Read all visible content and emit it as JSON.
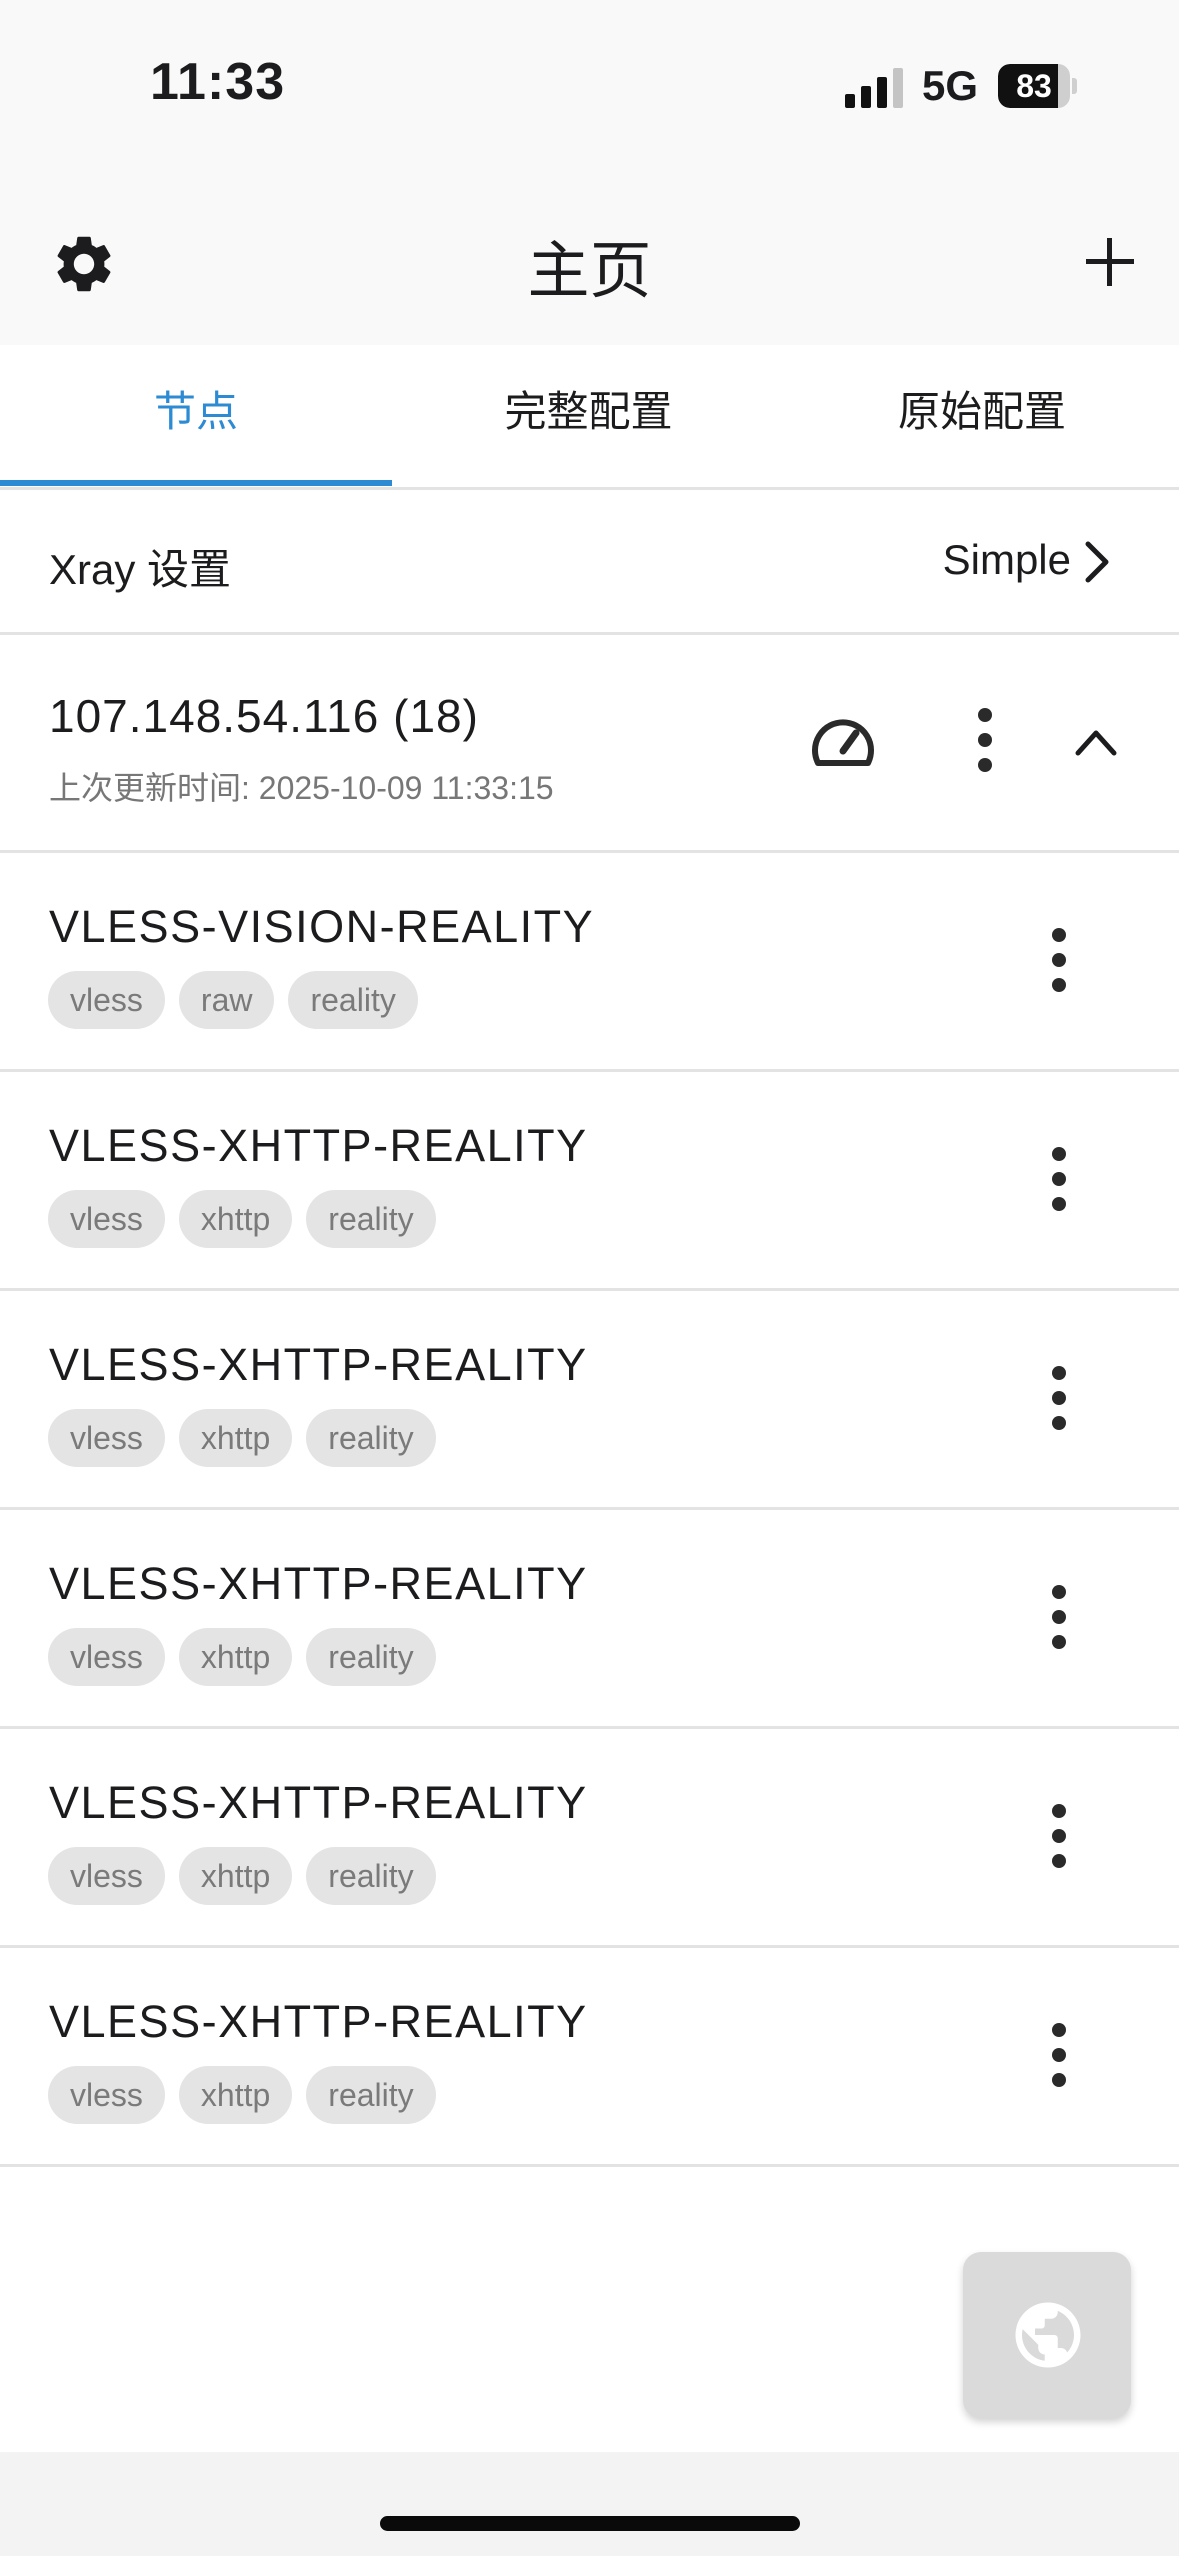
{
  "status_bar": {
    "time": "11:33",
    "network": "5G",
    "battery_percent": "83",
    "battery_level": 0.83
  },
  "app_bar": {
    "title": "主页",
    "left_icon": "gear-icon",
    "right_icon": "plus-icon"
  },
  "tabs": [
    {
      "label": "节点",
      "active": true
    },
    {
      "label": "完整配置",
      "active": false
    },
    {
      "label": "原始配置",
      "active": false
    }
  ],
  "accent_color": "#2d8bd4",
  "xray_settings": {
    "label": "Xray 设置",
    "value": "Simple"
  },
  "group": {
    "title": "107.148.54.116 (18)",
    "subtitle": "上次更新时间: 2025-10-09 11:33:15",
    "icons": [
      "speedometer-icon",
      "more-vert-icon",
      "chevron-up-icon"
    ]
  },
  "nodes": [
    {
      "name": "VLESS-VISION-REALITY",
      "tags": [
        "vless",
        "raw",
        "reality"
      ]
    },
    {
      "name": "VLESS-XHTTP-REALITY",
      "tags": [
        "vless",
        "xhttp",
        "reality"
      ]
    },
    {
      "name": "VLESS-XHTTP-REALITY",
      "tags": [
        "vless",
        "xhttp",
        "reality"
      ]
    },
    {
      "name": "VLESS-XHTTP-REALITY",
      "tags": [
        "vless",
        "xhttp",
        "reality"
      ]
    },
    {
      "name": "VLESS-XHTTP-REALITY",
      "tags": [
        "vless",
        "xhttp",
        "reality"
      ]
    },
    {
      "name": "VLESS-XHTTP-REALITY",
      "tags": [
        "vless",
        "xhttp",
        "reality"
      ]
    }
  ],
  "fab_icon": "globe-icon"
}
